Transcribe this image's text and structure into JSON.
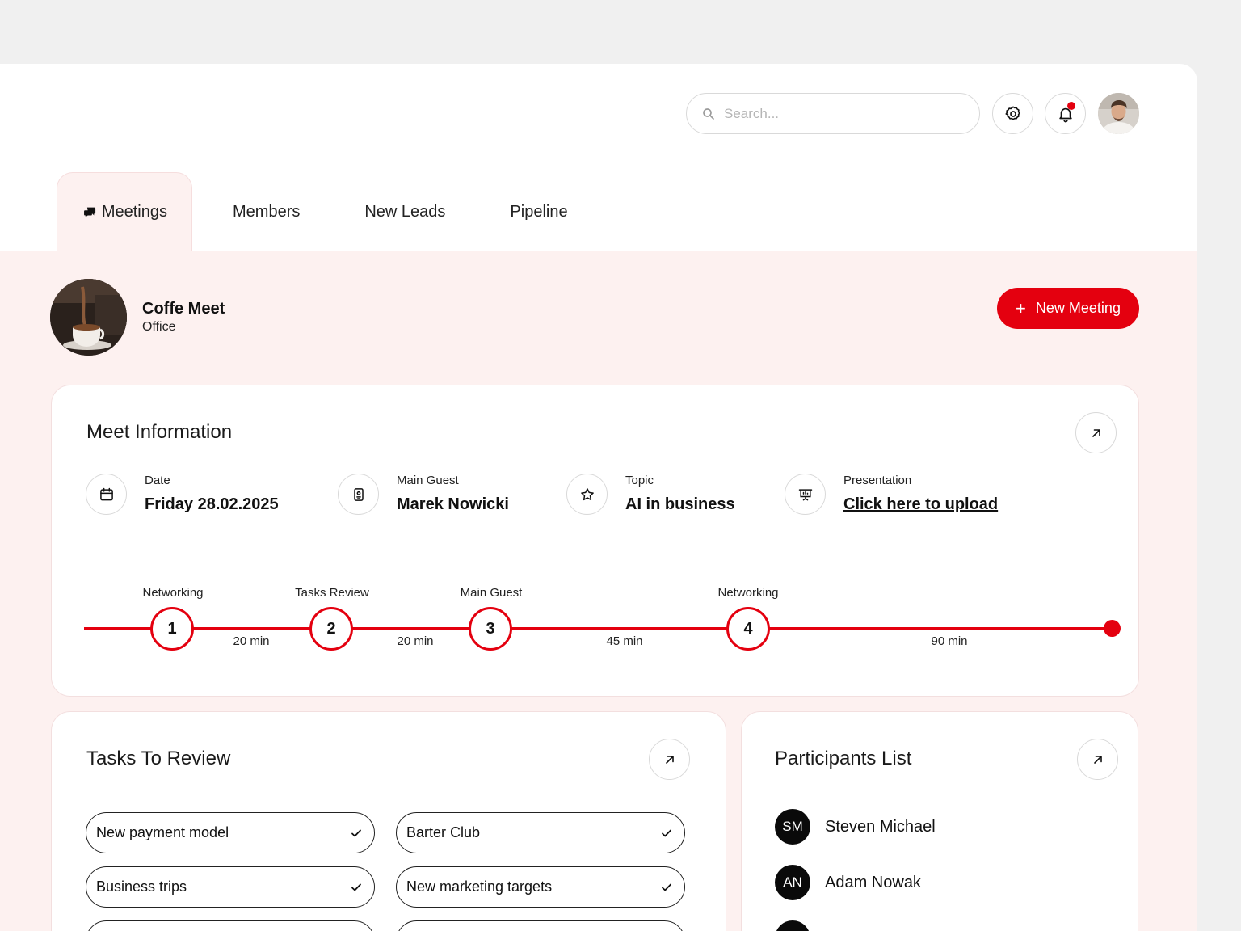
{
  "header": {
    "search_placeholder": "Search..."
  },
  "tabs": [
    {
      "label": "Meetings",
      "active": true
    },
    {
      "label": "Members",
      "active": false
    },
    {
      "label": "New Leads",
      "active": false
    },
    {
      "label": "Pipeline",
      "active": false
    }
  ],
  "meeting": {
    "title": "Coffe Meet",
    "subtitle": "Office",
    "new_button_label": "New Meeting"
  },
  "meet_info": {
    "title": "Meet Information",
    "items": [
      {
        "label": "Date",
        "value": "Friday 28.02.2025",
        "icon": "calendar-icon"
      },
      {
        "label": "Main Guest",
        "value": "Marek Nowicki",
        "icon": "badge-icon"
      },
      {
        "label": "Topic",
        "value": "AI in business",
        "icon": "star-icon"
      },
      {
        "label": "Presentation",
        "value": "Click here to upload",
        "icon": "presentation-icon"
      }
    ],
    "timeline": [
      {
        "step": "1",
        "label": "Networking",
        "duration": "20 min"
      },
      {
        "step": "2",
        "label": "Tasks Review",
        "duration": "20 min"
      },
      {
        "step": "3",
        "label": "Main Guest",
        "duration": "45 min"
      },
      {
        "step": "4",
        "label": "Networking",
        "duration": "90 min"
      }
    ]
  },
  "tasks": {
    "title": "Tasks To Review",
    "items": [
      "New payment model",
      "Barter Club",
      "Business trips",
      "New marketing targets"
    ]
  },
  "participants": {
    "title": "Participants List",
    "items": [
      {
        "initials": "SM",
        "name": "Steven Michael"
      },
      {
        "initials": "AN",
        "name": "Adam Nowak"
      }
    ]
  },
  "colors": {
    "accent": "#e4000f",
    "content_bg": "#fdf1f0",
    "page_bg": "#f0f0f0"
  }
}
